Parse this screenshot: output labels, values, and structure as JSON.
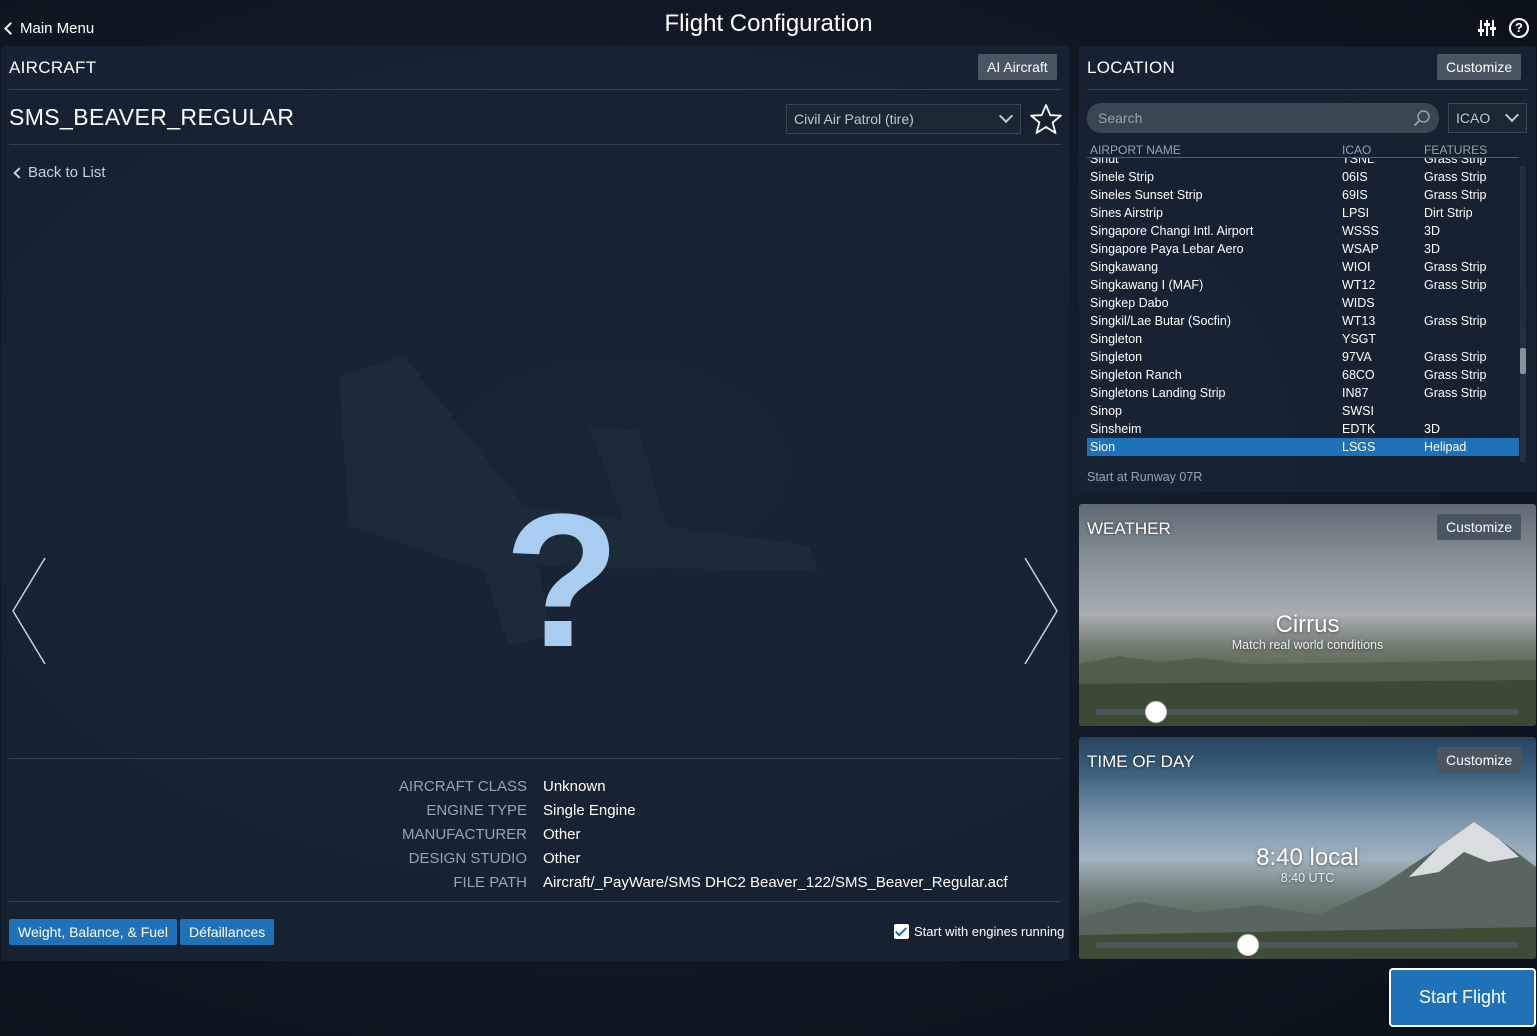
{
  "header": {
    "back_label": "Main Menu",
    "title": "Flight Configuration"
  },
  "aircraft": {
    "section_title": "AIRCRAFT",
    "ai_button": "AI Aircraft",
    "name": "SMS_BEAVER_REGULAR",
    "livery": "Civil Air Patrol (tire)",
    "back_to_list": "Back to List",
    "preview_placeholder": "?",
    "specs": [
      {
        "label": "AIRCRAFT CLASS",
        "value": "Unknown"
      },
      {
        "label": "ENGINE TYPE",
        "value": "Single Engine"
      },
      {
        "label": "MANUFACTURER",
        "value": "Other"
      },
      {
        "label": "DESIGN STUDIO",
        "value": "Other"
      },
      {
        "label": "FILE PATH",
        "value": "Aircraft/_PayWare/SMS DHC2 Beaver_122/SMS_Beaver_Regular.acf"
      }
    ],
    "weight_button": "Weight, Balance, & Fuel",
    "failures_button": "Défaillances",
    "engines_running_label": "Start with engines running",
    "engines_running_checked": true
  },
  "location": {
    "section_title": "LOCATION",
    "customize_label": "Customize",
    "search_placeholder": "Search",
    "sort_mode": "ICAO",
    "columns": {
      "name": "AIRPORT NAME",
      "icao": "ICAO",
      "features": "FEATURES"
    },
    "rows": [
      {
        "name": "Sinut",
        "icao": "TSNL",
        "features": "Grass Strip"
      },
      {
        "name": "Sinele Strip",
        "icao": "06IS",
        "features": "Grass Strip"
      },
      {
        "name": "Sineles Sunset Strip",
        "icao": "69IS",
        "features": "Grass Strip"
      },
      {
        "name": "Sines Airstrip",
        "icao": "LPSI",
        "features": "Dirt Strip"
      },
      {
        "name": "Singapore Changi Intl. Airport",
        "icao": "WSSS",
        "features": "3D"
      },
      {
        "name": "Singapore Paya Lebar Aero",
        "icao": "WSAP",
        "features": "3D"
      },
      {
        "name": "Singkawang",
        "icao": "WIOI",
        "features": "Grass Strip"
      },
      {
        "name": "Singkawang I (MAF)",
        "icao": "WT12",
        "features": "Grass Strip"
      },
      {
        "name": "Singkep Dabo",
        "icao": "WIDS",
        "features": ""
      },
      {
        "name": "Singkil/Lae Butar (Socfin)",
        "icao": "WT13",
        "features": "Grass Strip"
      },
      {
        "name": "Singleton",
        "icao": "YSGT",
        "features": ""
      },
      {
        "name": "Singleton",
        "icao": "97VA",
        "features": "Grass Strip"
      },
      {
        "name": "Singleton Ranch",
        "icao": "68CO",
        "features": "Grass Strip"
      },
      {
        "name": "Singletons Landing Strip",
        "icao": "IN87",
        "features": "Grass Strip"
      },
      {
        "name": "Sinop",
        "icao": "SWSI",
        "features": ""
      },
      {
        "name": "Sinsheim",
        "icao": "EDTK",
        "features": "3D"
      },
      {
        "name": "Sion",
        "icao": "LSGS",
        "features": "Helipad",
        "selected": true
      }
    ],
    "start_at": "Start at Runway 07R"
  },
  "weather": {
    "section_title": "WEATHER",
    "customize_label": "Customize",
    "condition": "Cirrus",
    "subtitle": "Match real world conditions",
    "slider_fraction": 0.145
  },
  "time_of_day": {
    "section_title": "TIME OF DAY",
    "customize_label": "Customize",
    "local": "8:40 local",
    "utc": "8:40 UTC",
    "slider_fraction": 0.36
  },
  "start_button": "Start Flight",
  "colors": {
    "accent": "#1f72b8",
    "panel": "#182434",
    "gray_button": "#4a5562"
  }
}
